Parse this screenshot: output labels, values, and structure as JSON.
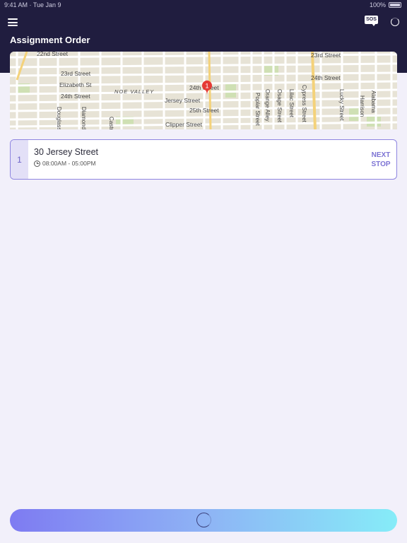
{
  "status_bar": {
    "time_date": "9:41 AM · Tue Jan 9",
    "battery": "100%"
  },
  "header": {
    "title": "Assignment Order",
    "menu_icon": "hamburger-menu-icon",
    "sos_label": "SOS",
    "loading_icon": "spinner-icon"
  },
  "map": {
    "streets": {
      "s22nd_left": "22nd Street",
      "s23rd_left": "23rd Street",
      "elizabeth": "Elizabeth St",
      "s24th_left": "24th Street",
      "noe_valley": "NOE VALLEY",
      "s24th_mid": "24th Street",
      "jersey": "Jersey Street",
      "s25th": "25th Street",
      "clipper": "Clipper Street",
      "douglass": "Douglass",
      "diamond": "Diamond",
      "castro": "Castro",
      "s23rd_right": "23rd Street",
      "s24th_right": "24th Street",
      "poplar": "Poplar Street",
      "orange": "Orange Alley",
      "osage": "Osage Street",
      "lilac": "Lilac Street",
      "cypress": "Cypress Street",
      "lucky": "Lucky Street",
      "harrison": "Harrison",
      "alabama": "Alabama"
    },
    "pin_label": "1",
    "pin_color": "#e53935"
  },
  "stops": [
    {
      "number": "1",
      "address": "30 Jersey Street",
      "time_window": "08:00AM - 05:00PM",
      "action_line1": "NEXT",
      "action_line2": "STOP"
    }
  ],
  "colors": {
    "header_bg": "#201d3f",
    "page_bg": "#f2f0fa",
    "accent": "#7d74d4",
    "gradient_start": "#7e7bf2",
    "gradient_end": "#86ecf8"
  }
}
